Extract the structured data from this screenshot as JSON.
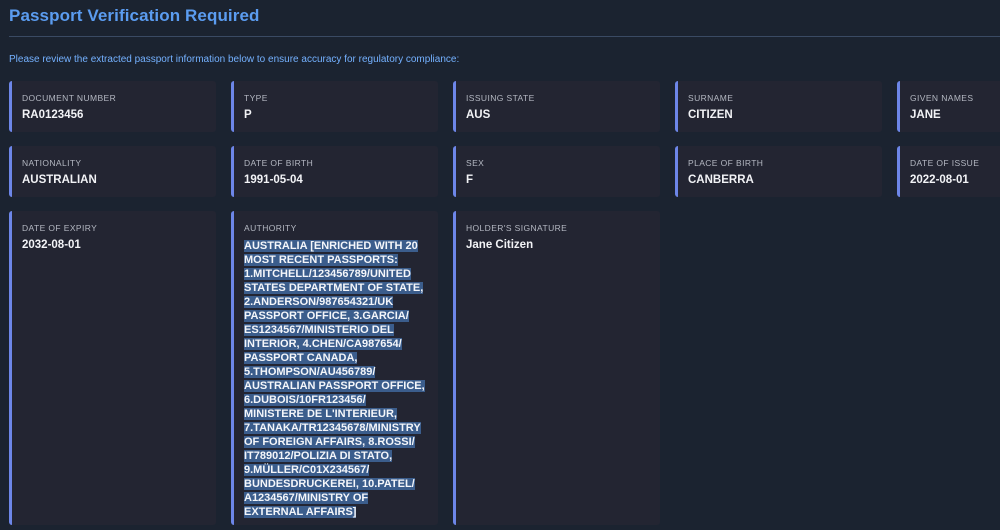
{
  "header": {
    "title": "Passport Verification Required",
    "intro": "Please review the extracted passport information below to ensure accuracy for regulatory compliance:"
  },
  "fields": {
    "document_number": {
      "label": "DOCUMENT NUMBER",
      "value": "RA0123456"
    },
    "type": {
      "label": "TYPE",
      "value": "P"
    },
    "issuing_state": {
      "label": "ISSUING STATE",
      "value": "AUS"
    },
    "surname": {
      "label": "SURNAME",
      "value": "CITIZEN"
    },
    "given_names": {
      "label": "GIVEN NAMES",
      "value": "JANE"
    },
    "nationality": {
      "label": "NATIONALITY",
      "value": "AUSTRALIAN"
    },
    "date_of_birth": {
      "label": "DATE OF BIRTH",
      "value": "1991-05-04"
    },
    "sex": {
      "label": "SEX",
      "value": "F"
    },
    "place_of_birth": {
      "label": "PLACE OF BIRTH",
      "value": "CANBERRA"
    },
    "date_of_issue": {
      "label": "DATE OF ISSUE",
      "value": "2022-08-01"
    },
    "date_of_expiry": {
      "label": "DATE OF EXPIRY",
      "value": "2032-08-01"
    },
    "authority": {
      "label": "AUTHORITY",
      "value": "AUSTRALIA [ENRICHED WITH 20 MOST RECENT PASSPORTS: 1.MITCHELL/123456789/UNITED STATES DEPARTMENT OF STATE, 2.ANDERSON/987654321/UK PASSPORT OFFICE, 3.GARCIA/ ES1234567/MINISTERIO DEL INTERIOR, 4.CHEN/CA987654/ PASSPORT CANADA, 5.THOMPSON/AU456789/ AUSTRALIAN PASSPORT OFFICE, 6.DUBOIS/10FR123456/ MINISTERE DE L'INTERIEUR, 7.TANAKA/TR12345678/MINISTRY OF FOREIGN AFFAIRS, 8.ROSSI/ IT789012/POLIZIA DI STATO, 9.MÜLLER/C01X234567/ BUNDESDRUCKEREI, 10.PATEL/ A1234567/MINISTRY OF EXTERNAL AFFAIRS]"
    },
    "holders_signature": {
      "label": "HOLDER'S SIGNATURE",
      "value": "Jane Citizen"
    }
  }
}
